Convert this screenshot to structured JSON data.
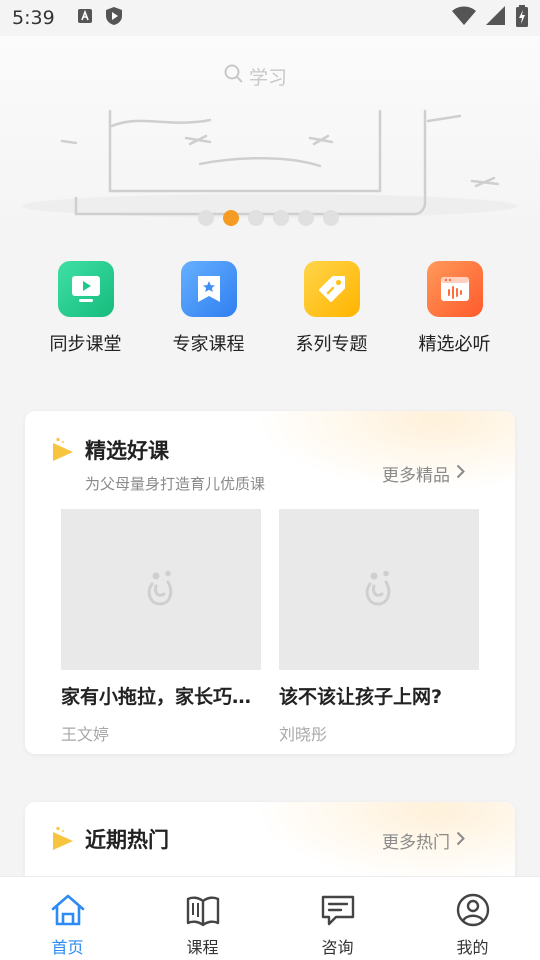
{
  "status_bar": {
    "time": "5:39",
    "left_icons": [
      "a-badge-icon",
      "shield-icon"
    ],
    "right_icons": [
      "wifi-icon",
      "signal-icon",
      "battery-charging-icon"
    ]
  },
  "search": {
    "placeholder": "学习"
  },
  "carousel": {
    "dot_count": 6,
    "active_index": 1
  },
  "quick_entries": [
    {
      "label": "同步课堂",
      "icon": "play-screen-icon",
      "color": "#1fc98a"
    },
    {
      "label": "专家课程",
      "icon": "bookmark-star-icon",
      "color": "#3d8ef7"
    },
    {
      "label": "系列专题",
      "icon": "tag-icon",
      "color": "#ffc21f"
    },
    {
      "label": "精选必听",
      "icon": "audio-window-icon",
      "color": "#ff6d3a"
    }
  ],
  "featured": {
    "title": "精选好课",
    "subtitle": "为父母量身打造育儿优质课",
    "more": "更多精品",
    "courses": [
      {
        "title": "家有小拖拉，家长巧…",
        "author": "王文婷"
      },
      {
        "title": "该不该让孩子上网?",
        "author": "刘晓彤"
      }
    ]
  },
  "hot": {
    "title": "近期热门",
    "more": "更多热门"
  },
  "tab_bar": {
    "active": "home",
    "tabs": [
      {
        "key": "home",
        "label": "首页",
        "icon": "home-icon"
      },
      {
        "key": "courses",
        "label": "课程",
        "icon": "book-icon"
      },
      {
        "key": "consult",
        "label": "咨询",
        "icon": "chat-icon"
      },
      {
        "key": "mine",
        "label": "我的",
        "icon": "user-icon"
      }
    ]
  },
  "colors": {
    "accent": "#2c8cf4",
    "dot_active": "#f59a23",
    "title_icon": "#f6c43f"
  }
}
